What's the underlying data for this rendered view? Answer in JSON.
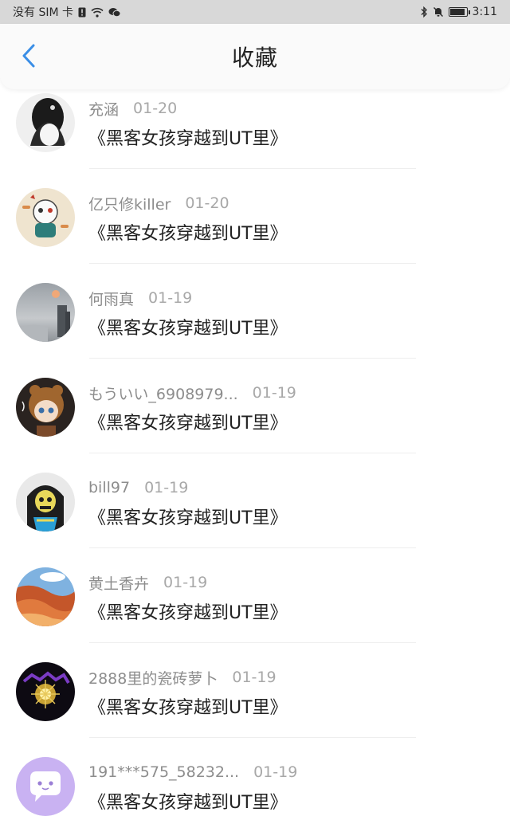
{
  "status_bar": {
    "carrier": "没有 SIM 卡",
    "time": "3:11",
    "battery_level": 0.9
  },
  "header": {
    "title": "收藏",
    "accent_color": "#3a8ee6"
  },
  "favorites": [
    {
      "user": "充涵",
      "date": "01-20",
      "title": "《黑客女孩穿越到UT里》",
      "avatar_icon": "avatar-dark-bird"
    },
    {
      "user": "亿只修killer",
      "date": "01-20",
      "title": "《黑客女孩穿越到UT里》",
      "avatar_icon": "avatar-skeleton-cartoon"
    },
    {
      "user": "何雨真",
      "date": "01-19",
      "title": "《黑客女孩穿越到UT里》",
      "avatar_icon": "avatar-misty-sky"
    },
    {
      "user": "もういい_6908979...",
      "date": "01-19",
      "title": "《黑客女孩穿越到UT里》",
      "avatar_icon": "avatar-anime-girl"
    },
    {
      "user": "bill97",
      "date": "01-19",
      "title": "《黑客女孩穿越到UT里》",
      "avatar_icon": "avatar-hooded-skeleton"
    },
    {
      "user": "黄土香卉",
      "date": "01-19",
      "title": "《黑客女孩穿越到UT里》",
      "avatar_icon": "avatar-canyon"
    },
    {
      "user": "2888里的瓷砖萝卜",
      "date": "01-19",
      "title": "《黑客女孩穿越到UT里》",
      "avatar_icon": "avatar-glowing-orb"
    },
    {
      "user": "191***575_58232...",
      "date": "01-19",
      "title": "《黑客女孩穿越到UT里》",
      "avatar_icon": "avatar-chat-bubble"
    }
  ]
}
